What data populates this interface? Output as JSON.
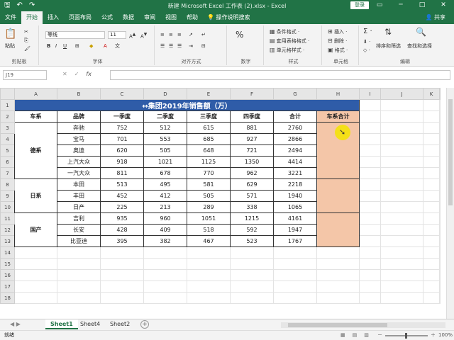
{
  "titlebar": {
    "title": "新建 Microsoft Excel 工作表 (2).xlsx  -  Excel",
    "login": "登录",
    "qat": [
      "save-icon",
      "undo-icon",
      "redo-icon"
    ]
  },
  "menu": {
    "tabs": [
      "文件",
      "开始",
      "插入",
      "页面布局",
      "公式",
      "数据",
      "审阅",
      "视图",
      "帮助"
    ],
    "tell": "操作说明搜索",
    "share": "共享"
  },
  "ribbon": {
    "paste": "粘贴",
    "clipboard": "剪贴板",
    "font_name": "等线",
    "font_size": "11",
    "font": "字体",
    "alignment": "对齐方式",
    "number": "数字",
    "cond_format": "条件格式 ·",
    "table_format": "套用表格格式 ·",
    "cell_style": "单元格样式 ·",
    "styles": "样式",
    "insert": "插入 ·",
    "delete": "删除 ·",
    "format": "格式 ·",
    "cells": "单元格",
    "sort_filter": "排序和筛选",
    "find_select": "查找和选择",
    "editing": "编辑"
  },
  "formula_bar": {
    "namebox": "J19",
    "fx": "fx",
    "value": ""
  },
  "grid": {
    "columns": [
      "A",
      "B",
      "C",
      "D",
      "E",
      "F",
      "G",
      "H",
      "I",
      "J",
      "K"
    ],
    "title": "↔集团2019年销售额（万）",
    "headers": [
      "车系",
      "品牌",
      "一季度",
      "二季度",
      "三季度",
      "四季度",
      "合计",
      "车系合计"
    ],
    "groups": [
      {
        "name": "德系",
        "rows": [
          [
            "奔驰",
            "752",
            "512",
            "615",
            "881",
            "2760"
          ],
          [
            "宝马",
            "701",
            "553",
            "685",
            "927",
            "2866"
          ],
          [
            "奥迪",
            "620",
            "505",
            "648",
            "721",
            "2494"
          ],
          [
            "上汽大众",
            "918",
            "1021",
            "1125",
            "1350",
            "4414"
          ],
          [
            "一汽大众",
            "811",
            "678",
            "770",
            "962",
            "3221"
          ]
        ]
      },
      {
        "name": "日系",
        "rows": [
          [
            "本田",
            "513",
            "495",
            "581",
            "629",
            "2218"
          ],
          [
            "丰田",
            "452",
            "412",
            "505",
            "571",
            "1940"
          ],
          [
            "日产",
            "225",
            "213",
            "289",
            "338",
            "1065"
          ]
        ]
      },
      {
        "name": "国产",
        "rows": [
          [
            "吉利",
            "935",
            "960",
            "1051",
            "1215",
            "4161"
          ],
          [
            "长安",
            "428",
            "409",
            "518",
            "592",
            "1947"
          ],
          [
            "比亚迪",
            "395",
            "382",
            "467",
            "523",
            "1767"
          ]
        ]
      }
    ]
  },
  "sheets": [
    "Sheet1",
    "Sheet4",
    "Sheet2"
  ],
  "status": {
    "ready": "就绪",
    "zoom": "100%"
  }
}
